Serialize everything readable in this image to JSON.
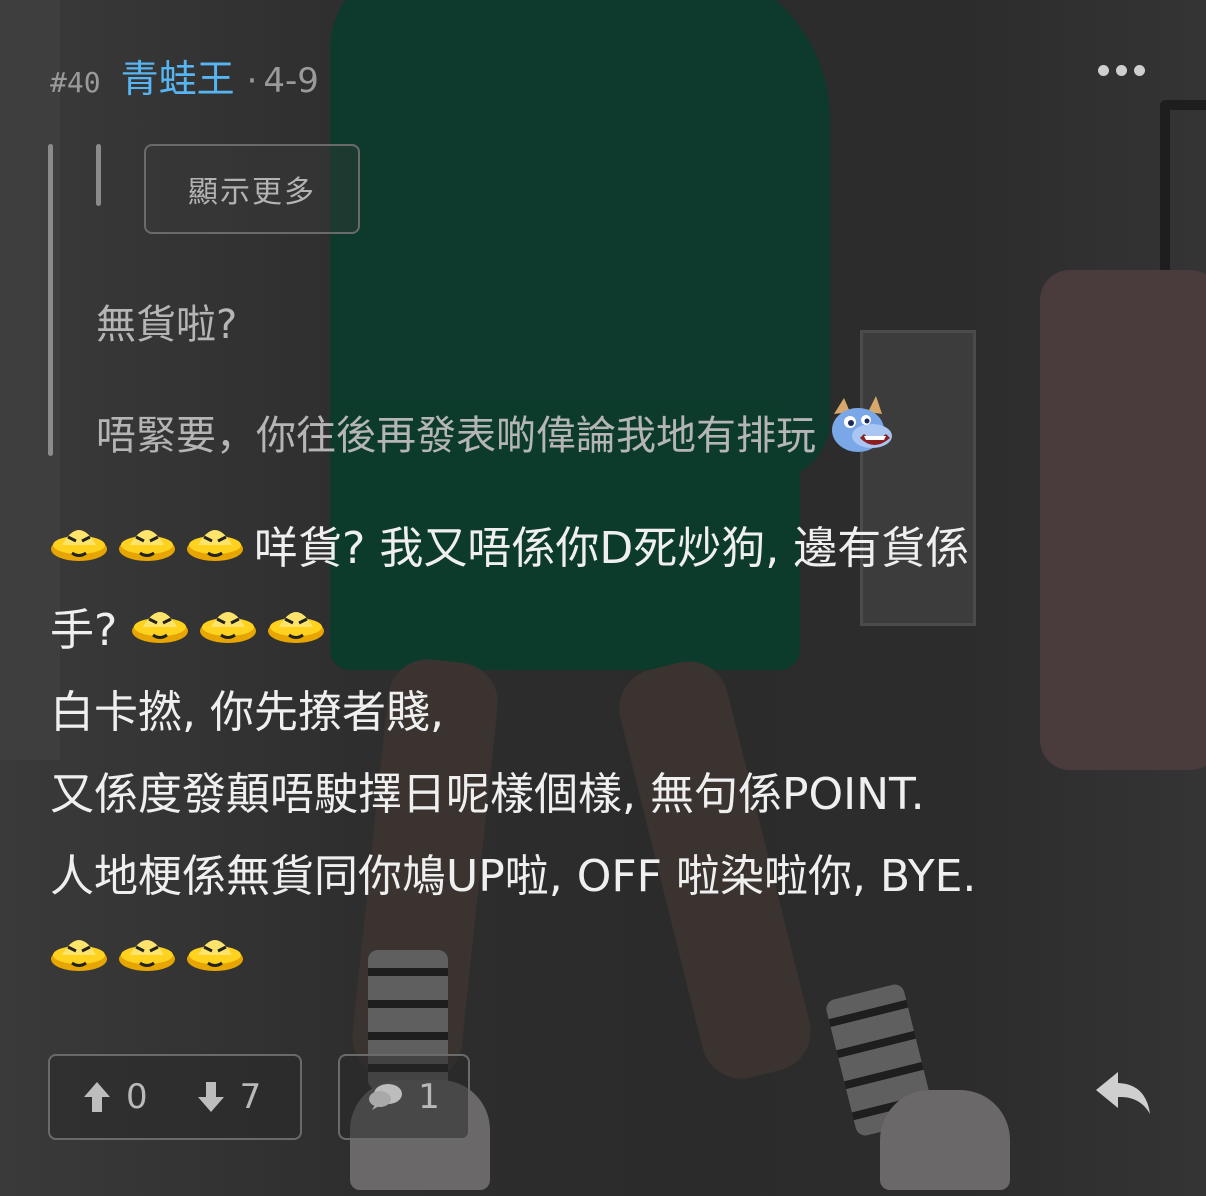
{
  "post": {
    "floor": "#40",
    "username": "青蛙王",
    "separator": "·",
    "date": "4-9"
  },
  "quote": {
    "show_more_label": "顯示更多",
    "line1": "無貨啦?",
    "line2": "唔緊要，你往後再發表啲偉論我地有排玩"
  },
  "body": {
    "line1_text": "咩貨? 我又唔係你D死炒狗, 邊有貨係",
    "line2_text": "手?",
    "line3_text": "白卡撚, 你先撩者賤,",
    "line4_text": "又係度發顛唔駛擇日呢樣個樣, 無句係POINT.",
    "line5_text": "人地梗係無貨同你鳩UP啦, OFF 啦染啦你, BYE."
  },
  "footer": {
    "upvotes": "0",
    "downvotes": "7",
    "replies": "1"
  },
  "icons": {
    "more": "more-options-icon",
    "upvote": "arrow-up-icon",
    "downvote": "arrow-down-icon",
    "replies": "comment-bubble-icon",
    "reply": "reply-arrow-icon",
    "emoticon_a": "ufo-face-emoticon-icon",
    "emoticon_b": "dragon-face-emoticon-icon"
  },
  "colors": {
    "username": "#56b5f2",
    "text": "#efefef",
    "muted": "#9a9a9a"
  }
}
